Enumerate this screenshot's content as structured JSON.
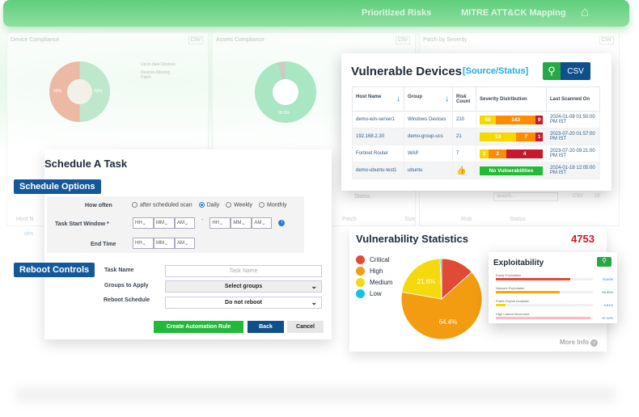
{
  "header": {
    "nav": [
      "Prioritized Risks",
      "MITRE ATT&CK Mapping"
    ],
    "home_icon": "home-icon"
  },
  "background": {
    "panels": [
      {
        "title": "Device Compliance",
        "csv": "CSV",
        "legend": [
          "Up-to-date Devices",
          "Devices Missing Patch"
        ],
        "values": [
          "50%",
          "50%"
        ]
      },
      {
        "title": "Assets Compliance",
        "csv": "CSV",
        "values": [
          "95.8%"
        ]
      },
      {
        "title": "Patch by Severity",
        "csv": "CSV"
      }
    ],
    "table": {
      "status_label": "Status :",
      "search_placeholder": "search...",
      "csv": "CSV",
      "page_size": "15",
      "columns": [
        "Patch",
        "Size",
        "Risk",
        "Status"
      ],
      "left_header": "Host N",
      "left_rows": [
        "des",
        "des"
      ]
    }
  },
  "vulnerable_devices": {
    "title": "Vulnerable Devices",
    "subtitle": "[Source/Status]",
    "csv_label": "CSV",
    "columns": [
      "Host Name",
      "Group",
      "Risk Count",
      "Severity Distribution",
      "Last Scanned On"
    ],
    "rows": [
      {
        "host": "demo-win-server1",
        "group": "Windows Devices",
        "risk": "210",
        "sev": [
          "58",
          "143",
          "9"
        ],
        "sev_weights": [
          58,
          143,
          9
        ],
        "scanned": "2024-01-08 01:50:00 PM IST"
      },
      {
        "host": "192.168.2.30",
        "group": "demo-group-ucs",
        "risk": "21",
        "sev": [
          "13",
          "7",
          "1"
        ],
        "sev_weights": [
          13,
          7,
          1
        ],
        "scanned": "2023-07-20 01:57:00 PM IST"
      },
      {
        "host": "Fortinet Router",
        "group": "WAP",
        "risk": "7",
        "sev": [
          "1",
          "2",
          "4"
        ],
        "sev_weights": [
          1,
          2,
          4
        ],
        "scanned": "2023-07-20 09:21:00 PM IST"
      },
      {
        "host": "demo-ubuntu-test1",
        "group": "ubuntu",
        "risk": "",
        "sev_none": "No Vulnerabilities",
        "scanned": "2024-01-18 12:05:00 PM IST"
      }
    ],
    "colors": {
      "medium": "#f5d800",
      "high": "#ff8c00",
      "critical": "#c8182c",
      "none": "#22bb33"
    }
  },
  "schedule": {
    "title": "Schedule A Task",
    "options_tag": "Schedule Options",
    "reboot_tag": "Reboot Controls",
    "how_often_label": "How often",
    "how_often_options": [
      "after scheduled scan",
      "Daily",
      "Weekly",
      "Monthly"
    ],
    "how_often_selected": "Daily",
    "start_window_label": "Task Start Window *",
    "end_time_label": "End Time",
    "hh": "HH",
    "mm": "MM",
    "ampm": "AM",
    "dash": "-",
    "task_name_label": "Task Name",
    "task_name_placeholder": "Task Name",
    "groups_label": "Groups to Apply",
    "groups_value": "Select groups",
    "reboot_label": "Reboot Schedule",
    "reboot_value": "Do not reboot",
    "buttons": {
      "create": "Create Automation Rule",
      "back": "Back",
      "cancel": "Cancel"
    }
  },
  "vuln_stats": {
    "title": "Vulnerability Statistics",
    "total": "4753",
    "more_info": "More Info",
    "chart_data": {
      "type": "pie",
      "categories": [
        "Critical",
        "High",
        "Medium",
        "Low"
      ],
      "values": [
        13.4,
        64.4,
        21.6,
        0.6
      ],
      "labels": [
        "",
        "64.4%",
        "21.6%",
        ""
      ],
      "colors": [
        "#e04b35",
        "#f39c12",
        "#f5d90f",
        "#17c3dc"
      ]
    },
    "exploitability": {
      "title": "Exploitability",
      "items": [
        {
          "name": "Easily Exploitable",
          "value": "76.60%",
          "pct": 76.6,
          "color": "#e04b35"
        },
        {
          "name": "Network Exploitable",
          "value": "65.80%",
          "pct": 65.8,
          "color": "#ffa500"
        },
        {
          "name": "Public Exploit Available",
          "value": "9.61%",
          "pct": 9.61,
          "color": "#f5d800"
        },
        {
          "name": "High Lateral Movement",
          "value": "97.42%",
          "pct": 97.42,
          "color": "#ffb6c8"
        }
      ]
    }
  }
}
